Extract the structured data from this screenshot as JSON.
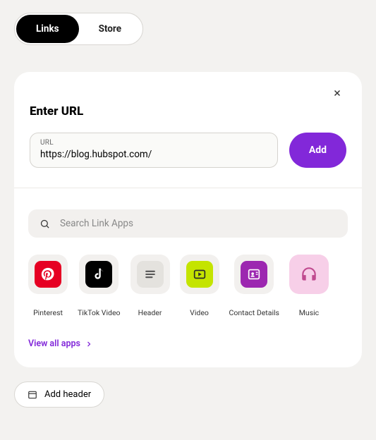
{
  "tabs": {
    "links": "Links",
    "store": "Store"
  },
  "card": {
    "title": "Enter URL",
    "url_label": "URL",
    "url_value": "https://blog.hubspot.com/",
    "add_label": "Add"
  },
  "search": {
    "placeholder": "Search Link Apps"
  },
  "apps": {
    "pinterest": "Pinterest",
    "tiktok": "TikTok Video",
    "header": "Header",
    "video": "Video",
    "contact": "Contact Details",
    "music": "Music"
  },
  "view_all": "View all apps",
  "add_header": "Add header"
}
